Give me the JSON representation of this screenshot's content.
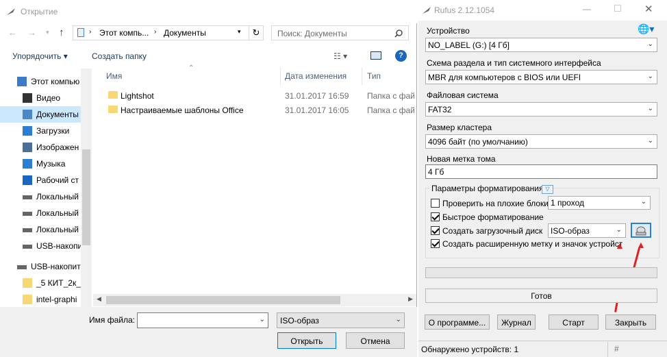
{
  "open_dialog": {
    "title": "Открытие",
    "breadcrumb": [
      "Этот компь...",
      "Документы"
    ],
    "search_placeholder": "Поиск: Документы",
    "toolbar": {
      "organize": "Упорядочить",
      "new_folder": "Создать папку"
    },
    "sidebar": [
      {
        "label": "Этот компью",
        "icon": "computer-icon",
        "top": true
      },
      {
        "label": "Видео",
        "icon": "video-icon"
      },
      {
        "label": "Документы",
        "icon": "document-icon",
        "selected": true
      },
      {
        "label": "Загрузки",
        "icon": "download-icon"
      },
      {
        "label": "Изображен",
        "icon": "image-icon"
      },
      {
        "label": "Музыка",
        "icon": "music-icon"
      },
      {
        "label": "Рабочий ст",
        "icon": "desktop-icon"
      },
      {
        "label": "Локальный",
        "icon": "drive-icon"
      },
      {
        "label": "Локальный",
        "icon": "drive-icon"
      },
      {
        "label": "Локальный",
        "icon": "drive-icon"
      },
      {
        "label": "USB-накопи",
        "icon": "usb-icon"
      },
      {
        "label": "USB-накопит",
        "icon": "usb-icon",
        "top": true
      },
      {
        "label": "_5 КИТ_2к_",
        "icon": "folder-icon"
      },
      {
        "label": "intel-graphi",
        "icon": "folder-icon"
      }
    ],
    "columns": {
      "name": "Имя",
      "date": "Дата изменения",
      "type": "Тип"
    },
    "files": [
      {
        "name": "Lightshot",
        "date": "31.01.2017 16:59",
        "type": "Папка с файл"
      },
      {
        "name": "Настраиваемые шаблоны Office",
        "date": "31.01.2017 16:05",
        "type": "Папка с файл"
      }
    ],
    "filename_label": "Имя файла:",
    "filename_value": "",
    "filetype": "ISO-образ",
    "open_btn": "Открыть",
    "cancel_btn": "Отмена"
  },
  "rufus": {
    "title": "Rufus 2.12.1054",
    "device_label": "Устройство",
    "device_value": "NO_LABEL (G:) [4 Гб]",
    "scheme_label": "Схема раздела и тип системного интерфейса",
    "scheme_value": "MBR для компьютеров с BIOS или UEFI",
    "fs_label": "Файловая система",
    "fs_value": "FAT32",
    "cluster_label": "Размер кластера",
    "cluster_value": "4096 байт (по умолчанию)",
    "volume_label": "Новая метка тома",
    "volume_value": "4 Гб",
    "format_group": "Параметры форматирования",
    "check_bad": "Проверить на плохие блоки",
    "passes": "1 проход",
    "quick_format": "Быстрое форматирование",
    "bootable": "Создать загрузочный диск",
    "boot_type": "ISO-образ",
    "extended_label": "Создать расширенную метку и значок устройства",
    "checks": {
      "bad_blocks": false,
      "quick": true,
      "bootable": true,
      "extended": true
    },
    "progress": 0,
    "status_text": "Готов",
    "about_btn": "О программе...",
    "log_btn": "Журнал",
    "start_btn": "Старт",
    "close_btn": "Закрыть",
    "devices_found": "Обнаружено устройств: 1",
    "hash_btn": "#",
    "colors": {
      "selected": "#cce8ff",
      "arrow": "#e02020",
      "link": "#1e395b"
    }
  }
}
